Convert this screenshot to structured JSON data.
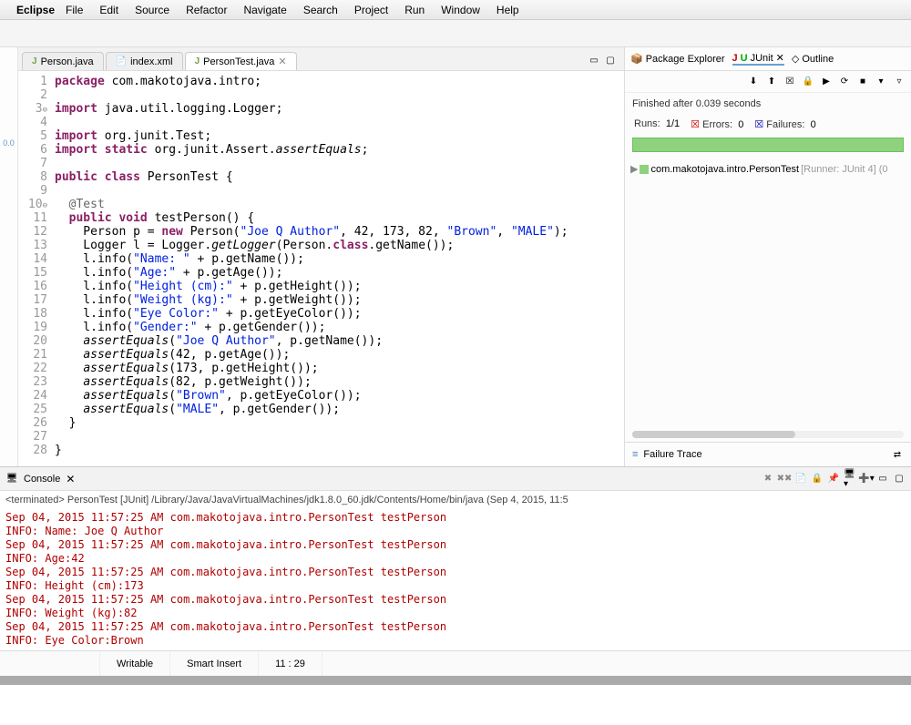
{
  "menubar": {
    "app": "Eclipse",
    "items": [
      "File",
      "Edit",
      "Source",
      "Refactor",
      "Navigate",
      "Search",
      "Project",
      "Run",
      "Window",
      "Help"
    ]
  },
  "editor": {
    "tabs": [
      {
        "label": "Person.java",
        "icon": "J"
      },
      {
        "label": "index.xml",
        "icon": "x"
      },
      {
        "label": "PersonTest.java",
        "icon": "J",
        "active": true
      }
    ],
    "code_lines": [
      {
        "n": "1",
        "html": "<span class='kw'>package</span> com.makotojava.intro;"
      },
      {
        "n": "2",
        "html": ""
      },
      {
        "n": "3",
        "fold": true,
        "html": "<span class='kw'>import</span> java.util.logging.Logger;"
      },
      {
        "n": "4",
        "html": ""
      },
      {
        "n": "5",
        "html": "<span class='kw'>import</span> org.junit.Test;"
      },
      {
        "n": "6",
        "html": "<span class='kw'>import static</span> org.junit.Assert.<span class='ital'>assertEquals</span>;"
      },
      {
        "n": "7",
        "html": ""
      },
      {
        "n": "8",
        "html": "<span class='kw'>public class</span> PersonTest {"
      },
      {
        "n": "9",
        "html": ""
      },
      {
        "n": "10",
        "fold": true,
        "html": "  <span class='ann'>@Test</span>"
      },
      {
        "n": "11",
        "html": "  <span class='kw'>public void</span> testPerson() {"
      },
      {
        "n": "12",
        "html": "    Person p = <span class='kw'>new</span> Person(<span class='str'>\"Joe Q Author\"</span>, 42, 173, 82, <span class='str'>\"Brown\"</span>, <span class='str'>\"MALE\"</span>);"
      },
      {
        "n": "13",
        "html": "    Logger l = Logger.<span class='ital'>getLogger</span>(Person.<span class='kw'>class</span>.getName());"
      },
      {
        "n": "14",
        "html": "    l.info(<span class='str'>\"Name: \"</span> + p.getName());"
      },
      {
        "n": "15",
        "html": "    l.info(<span class='str'>\"Age:\"</span> + p.getAge());"
      },
      {
        "n": "16",
        "html": "    l.info(<span class='str'>\"Height (cm):\"</span> + p.getHeight());"
      },
      {
        "n": "17",
        "html": "    l.info(<span class='str'>\"Weight (kg):\"</span> + p.getWeight());"
      },
      {
        "n": "18",
        "html": "    l.info(<span class='str'>\"Eye Color:\"</span> + p.getEyeColor());"
      },
      {
        "n": "19",
        "html": "    l.info(<span class='str'>\"Gender:\"</span> + p.getGender());"
      },
      {
        "n": "20",
        "html": "    <span class='ital'>assertEquals</span>(<span class='str'>\"Joe Q Author\"</span>, p.getName());"
      },
      {
        "n": "21",
        "html": "    <span class='ital'>assertEquals</span>(42, p.getAge());"
      },
      {
        "n": "22",
        "html": "    <span class='ital'>assertEquals</span>(173, p.getHeight());"
      },
      {
        "n": "23",
        "html": "    <span class='ital'>assertEquals</span>(82, p.getWeight());"
      },
      {
        "n": "24",
        "html": "    <span class='ital'>assertEquals</span>(<span class='str'>\"Brown\"</span>, p.getEyeColor());"
      },
      {
        "n": "25",
        "html": "    <span class='ital'>assertEquals</span>(<span class='str'>\"MALE\"</span>, p.getGender());"
      },
      {
        "n": "26",
        "html": "  }"
      },
      {
        "n": "27",
        "html": ""
      },
      {
        "n": "28",
        "html": "}"
      }
    ]
  },
  "left_gutter": "0.0",
  "junit": {
    "tabs": {
      "package_explorer": "Package Explorer",
      "junit": "JUnit",
      "outline": "Outline"
    },
    "finished": "Finished after 0.039 seconds",
    "runs_label": "Runs:",
    "runs_value": "1/1",
    "errors_label": "Errors:",
    "errors_value": "0",
    "failures_label": "Failures:",
    "failures_value": "0",
    "tree_item": "com.makotojava.intro.PersonTest",
    "tree_runner": "[Runner: JUnit 4] (0",
    "failure_trace": "Failure Trace"
  },
  "console": {
    "title": "Console",
    "description": "<terminated> PersonTest [JUnit] /Library/Java/JavaVirtualMachines/jdk1.8.0_60.jdk/Contents/Home/bin/java (Sep 4, 2015, 11:5",
    "output": [
      {
        "cls": "red",
        "text": "Sep 04, 2015 11:57:25 AM com.makotojava.intro.PersonTest testPerson"
      },
      {
        "cls": "red",
        "text": "INFO: Name: Joe Q Author"
      },
      {
        "cls": "red",
        "text": "Sep 04, 2015 11:57:25 AM com.makotojava.intro.PersonTest testPerson"
      },
      {
        "cls": "red",
        "text": "INFO: Age:42"
      },
      {
        "cls": "red",
        "text": "Sep 04, 2015 11:57:25 AM com.makotojava.intro.PersonTest testPerson"
      },
      {
        "cls": "red",
        "text": "INFO: Height (cm):173"
      },
      {
        "cls": "red",
        "text": "Sep 04, 2015 11:57:25 AM com.makotojava.intro.PersonTest testPerson"
      },
      {
        "cls": "red",
        "text": "INFO: Weight (kg):82"
      },
      {
        "cls": "red",
        "text": "Sep 04, 2015 11:57:25 AM com.makotojava.intro.PersonTest testPerson"
      },
      {
        "cls": "red",
        "text": "INFO: Eye Color:Brown"
      }
    ]
  },
  "statusbar": {
    "writable": "Writable",
    "mode": "Smart Insert",
    "cursor": "11 : 29"
  }
}
